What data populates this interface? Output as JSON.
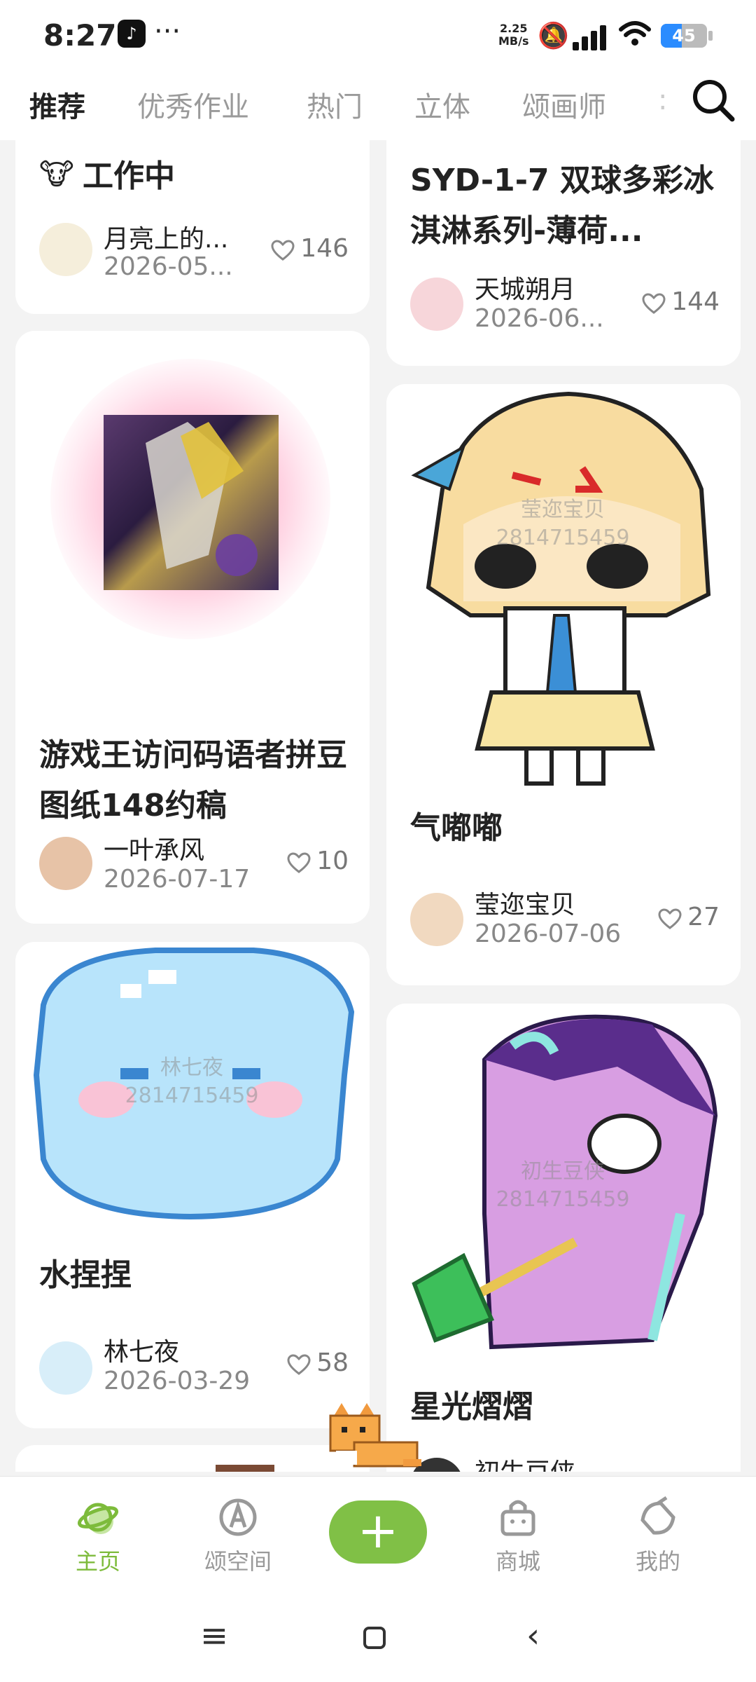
{
  "status_bar": {
    "time": "8:27",
    "network_speed_value": "2.25",
    "network_speed_unit": "MB/s",
    "battery": "45"
  },
  "tabs": {
    "items": [
      "推荐",
      "优秀作业",
      "热门",
      "立体",
      "颂画师"
    ],
    "active_index": 0
  },
  "feed": {
    "cards": [
      {
        "title": "工作中",
        "author": "月亮上的...",
        "date": "2026-05...",
        "likes": "146"
      },
      {
        "title": "SYD-1-7 双球多彩冰淇淋系列-薄荷...",
        "author": "天城朔月",
        "date": "2026-06...",
        "likes": "144"
      },
      {
        "title": "游戏王访问码语者拼豆图纸148约稿",
        "author": "一叶承风",
        "date": "2026-07-17",
        "likes": "10"
      },
      {
        "title": "气嘟嘟",
        "author": "莹迩宝贝",
        "date": "2026-07-06",
        "likes": "27",
        "watermark_name": "莹迩宝贝",
        "watermark_id": "2814715459"
      },
      {
        "title": "水捏捏",
        "author": "林七夜",
        "date": "2026-03-29",
        "likes": "58",
        "watermark_name": "林七夜",
        "watermark_id": "2814715459"
      },
      {
        "title": "星光熠熠",
        "author": "初生豆侠",
        "watermark_name": "初生豆侠",
        "watermark_id": "2814715459"
      }
    ]
  },
  "bottom_nav": {
    "home": "主页",
    "space": "颂空间",
    "shop": "商城",
    "mine": "我的"
  },
  "colors": {
    "accent": "#80c046",
    "active_nav": "#7dbb3b"
  }
}
